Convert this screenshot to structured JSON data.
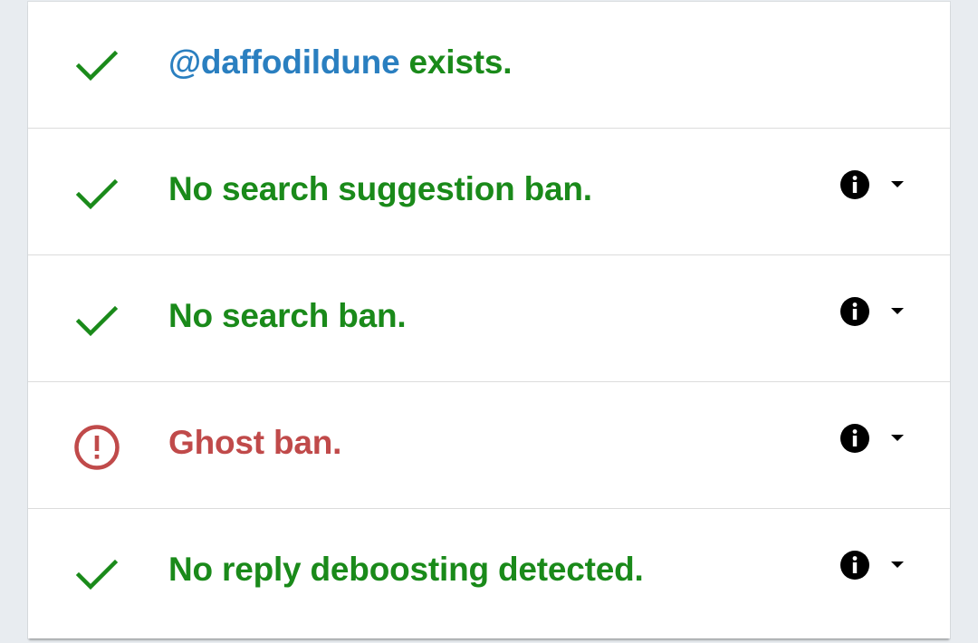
{
  "colors": {
    "ok": "#1a8a1a",
    "bad": "#c04a4a",
    "handle": "#2a7fc0",
    "background": "#e8ecf0",
    "card": "#ffffff"
  },
  "rows": [
    {
      "status": "ok",
      "icon": "checkmark-icon",
      "handle": "@daffodildune",
      "text": " exists.",
      "has_controls": false
    },
    {
      "status": "ok",
      "icon": "checkmark-icon",
      "text": "No search suggestion ban.",
      "has_controls": true
    },
    {
      "status": "ok",
      "icon": "checkmark-icon",
      "text": "No search ban.",
      "has_controls": true
    },
    {
      "status": "bad",
      "icon": "alert-circle-icon",
      "text": "Ghost ban.",
      "has_controls": true
    },
    {
      "status": "ok",
      "icon": "checkmark-icon",
      "text": "No reply deboosting detected.",
      "has_controls": true
    }
  ]
}
